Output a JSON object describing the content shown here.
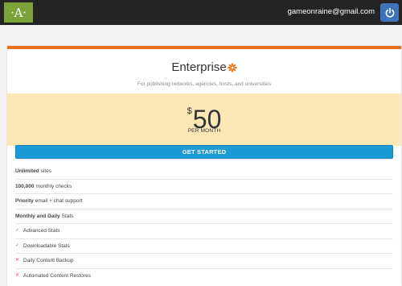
{
  "header": {
    "logo_letter": "A",
    "user_email": "gameonraine@gmail.com",
    "logo_color": "#7ba33a",
    "power_button_color": "#3f72b8",
    "power_icon": "power-icon"
  },
  "plan": {
    "name": "Enterprise",
    "name_icon": "gear-icon",
    "subtitle": "For publishing networks, agencies, hosts, and universities",
    "price_currency": "$",
    "price_amount": "50",
    "price_period": "PER MONTH",
    "cta_label": "GET STARTED",
    "accent_color": "#e8701f",
    "price_band_color": "#fbe8b6",
    "cta_color": "#1c9ad6"
  },
  "features": [
    {
      "bold": "Unlimited",
      "text": "sites",
      "mark": ""
    },
    {
      "bold": "100,000",
      "text": "monthly checks",
      "mark": ""
    },
    {
      "bold": "Priority",
      "text": "email + chat support",
      "mark": ""
    },
    {
      "bold": "Monthly and Daily",
      "text": "Stats",
      "mark": ""
    },
    {
      "bold": "",
      "text": "Advanced Stats",
      "mark": "✓"
    },
    {
      "bold": "",
      "text": "Downloadable Stats",
      "mark": "✓"
    },
    {
      "bold": "",
      "text": "Daily Content Backup",
      "mark": "✕"
    },
    {
      "bold": "",
      "text": "Automated Content Restores",
      "mark": "✕"
    }
  ]
}
